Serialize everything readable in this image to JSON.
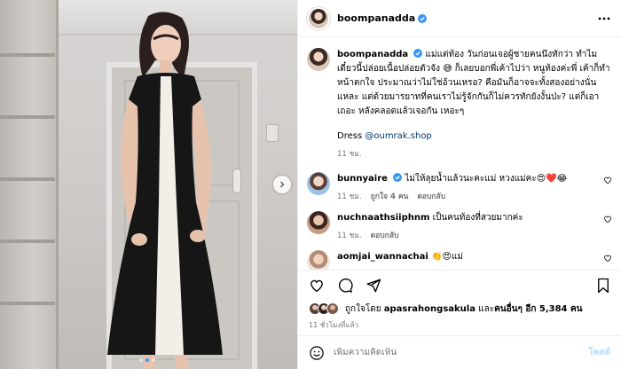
{
  "post": {
    "username": "boompanadda",
    "caption": "แม่แต่ท้อง วันก่อนเจอผู้ชายคนนึงทักว่า ทำไมเดี๋ยวนี้ปล่อยเนื้อปล่อยตัวจัง 😅 ก็เลยบอกพี่เค้าไปว่า หนูท้องค่ะพี่ เค้าก็ทำหน้าตกใจ ประมาณว่าไม่ใช่อ้วนเหรอ? คือมันก็อาจจะทั้งสองอย่างนั่นแหละ แต่ด้วยมารยาทที่คนเราไม่รู้จักกันก็ไม่ควรทักยังงั้นป่ะ? แต่ก็เอาเถอะ หลังคลอดแล้วเจอกัน เหอะๆ",
    "dress_label": "Dress",
    "dress_handle": "@oumrak.shop",
    "caption_time": "11 ชม."
  },
  "comments": [
    {
      "username": "bunnyaire",
      "verified": true,
      "text": "ไม่ให้ลุยน้ำแล้วนะคะแม่ หวงแม่คะ😍❤️😂",
      "time": "11 ชม.",
      "likes": "ถูกใจ 4 คน",
      "reply": "ตอบกลับ"
    },
    {
      "username": "nuchnaathsiiphnm",
      "verified": false,
      "text": "เป็นคนท้องที่สวยมากค่ะ",
      "time": "11 ชม.",
      "likes": "",
      "reply": "ตอบกลับ"
    },
    {
      "username": "aomjai_wannachai",
      "verified": false,
      "text": "👏😍แม่",
      "time": "",
      "likes": "",
      "reply": ""
    }
  ],
  "likes_summary": {
    "prefix": "ถูกใจโดย",
    "user": "apasrahongsakula",
    "middle": "และ",
    "others": "คนอื่นๆ อีก 5,384 คน"
  },
  "time_ago": "11 ชั่วโมงที่แล้ว",
  "add_comment": {
    "placeholder": "เพิ่มความคิดเห็น",
    "post_label": "โพสต์"
  },
  "colors": {
    "accent": "#3797f0",
    "like_red": "#ed4956",
    "muted": "#737373"
  },
  "carousel": {
    "slides": 3,
    "active_index": 1
  }
}
